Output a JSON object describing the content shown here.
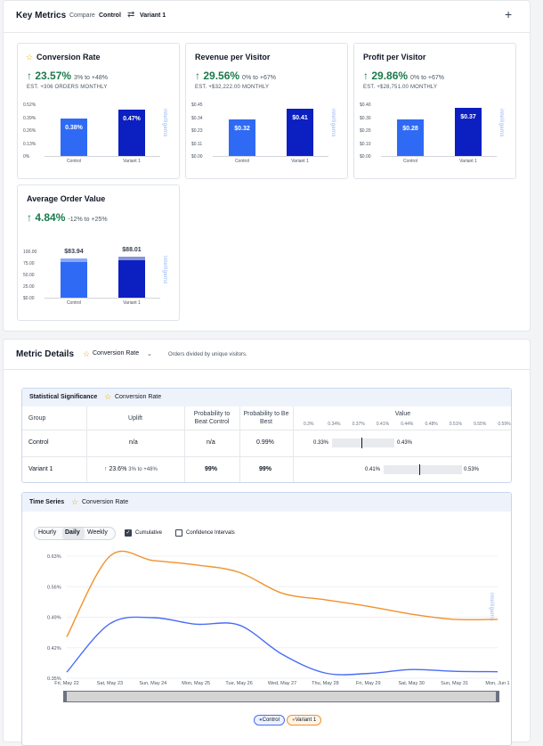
{
  "header": {
    "title": "Key Metrics",
    "compare_label": "Compare",
    "control_label": "Control",
    "swap_icon": "swap-arrows-icon",
    "variant_label": "Variant 1",
    "add_icon": "plus-icon"
  },
  "cards": [
    {
      "title": "Conversion Rate",
      "starred": true,
      "uplift": "23.57%",
      "range": "3% to +48%",
      "est": "EST. +306 ORDERS MONTHLY",
      "yticks": [
        "0.52%",
        "0.39%",
        "0.26%",
        "0.13%",
        "0%"
      ],
      "bars": [
        {
          "label": "Control",
          "value_text": "0.38%",
          "value": 0.38
        },
        {
          "label": "Variant 1",
          "value_text": "0.47%",
          "value": 0.47
        }
      ],
      "ymax": 0.52
    },
    {
      "title": "Revenue per Visitor",
      "starred": false,
      "uplift": "29.56%",
      "range": "0% to +67%",
      "est": "EST. +$32,222.00 MONTHLY",
      "yticks": [
        "$0.45",
        "$0.34",
        "$0.23",
        "$0.11",
        "$0.00"
      ],
      "bars": [
        {
          "label": "Control",
          "value_text": "$0.32",
          "value": 0.32
        },
        {
          "label": "Variant 1",
          "value_text": "$0.41",
          "value": 0.41
        }
      ],
      "ymax": 0.45
    },
    {
      "title": "Profit per Visitor",
      "starred": false,
      "uplift": "29.86%",
      "range": "0% to +67%",
      "est": "EST. +$28,751.00 MONTHLY",
      "yticks": [
        "$0.40",
        "$0.30",
        "$0.20",
        "$0.10",
        "$0.00"
      ],
      "bars": [
        {
          "label": "Control",
          "value_text": "$0.28",
          "value": 0.28
        },
        {
          "label": "Variant 1",
          "value_text": "$0.37",
          "value": 0.37
        }
      ],
      "ymax": 0.4
    },
    {
      "title": "Average Order Value",
      "starred": false,
      "uplift": "4.84%",
      "range": "-12% to +25%",
      "est": "",
      "yticks": [
        "100.00",
        "75.00",
        "50.00",
        "25.00",
        "$0.00"
      ],
      "bars": [
        {
          "label": "Control",
          "value_text": "$83.94",
          "value": 83.94
        },
        {
          "label": "Variant 1",
          "value_text": "$88.01",
          "value": 88.01
        }
      ],
      "ymax": 100
    }
  ],
  "watermark": "intelligems",
  "details": {
    "title": "Metric Details",
    "metric_select": "Conversion Rate",
    "description": "Orders divided by unique visitors."
  },
  "stat": {
    "title": "Statistical Significance",
    "metric": "Conversion Rate",
    "headers": {
      "group": "Group",
      "uplift": "Uplift",
      "prob_beat": "Probability to Beat Control",
      "prob_best": "Probability to Be Best",
      "value": "Value"
    },
    "value_ticks": [
      "0.3%",
      "0.34%",
      "0.37%",
      "0.41%",
      "0.44%",
      "0.48%",
      "0.51%",
      "0.55%",
      "0.59%"
    ],
    "rows": [
      {
        "group": "Control",
        "uplift": "n/a",
        "uplift_range": "",
        "prob_beat": "n/a",
        "prob_best": "0.99%",
        "ci_low": "0.33%",
        "ci_high": "0.43%"
      },
      {
        "group": "Variant 1",
        "uplift": "23.6%",
        "uplift_range": "3% to +48%",
        "prob_beat": "99%",
        "prob_best": "99%",
        "ci_low": "0.41%",
        "ci_high": "0.53%"
      }
    ]
  },
  "timeseries": {
    "title": "Time Series",
    "metric": "Conversion Rate",
    "tabs": [
      "Hourly",
      "Daily",
      "Weekly"
    ],
    "active_tab": "Daily",
    "cumulative_label": "Cumulative",
    "ci_label": "Confidence Intervals",
    "legend": [
      "Control",
      "Variant 1"
    ]
  },
  "chart_data": {
    "type": "line",
    "x": [
      "Fri, May 22",
      "Sat, May 23",
      "Sun, May 24",
      "Mon, May 25",
      "Tue, May 26",
      "Wed, May 27",
      "Thu, May 28",
      "Fri, May 29",
      "Sat, May 30",
      "Sun, May 31",
      "Mon, Jun 1"
    ],
    "yticks": [
      "0.63%",
      "0.56%",
      "0.49%",
      "0.42%",
      "0.35%"
    ],
    "ylim": [
      0.35,
      0.63
    ],
    "series": [
      {
        "name": "Control",
        "color": "#4a6cf7",
        "values": [
          0.364,
          0.475,
          0.489,
          0.474,
          0.472,
          0.405,
          0.362,
          0.361,
          0.37,
          0.366,
          0.365
        ]
      },
      {
        "name": "Variant 1",
        "color": "#f0922b",
        "values": [
          0.445,
          0.63,
          0.62,
          0.61,
          0.593,
          0.545,
          0.53,
          0.515,
          0.497,
          0.485,
          0.485
        ]
      }
    ],
    "grid": true,
    "legend": "bottom"
  },
  "colors": {
    "control_bar": "#2f6af5",
    "variant_bar": "#0c1fc0",
    "positive": "#1a7a4c",
    "star": "#e8b300"
  }
}
